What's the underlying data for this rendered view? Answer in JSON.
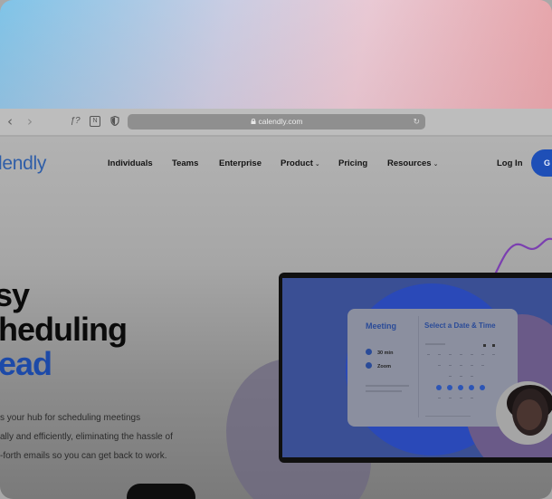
{
  "browser": {
    "url": "calendly.com",
    "back_icon": "chevron-left-icon",
    "forward_icon": "chevron-right-icon",
    "ext1_label": "ƒ?",
    "ext2_label": "N",
    "reload_icon": "reload-icon"
  },
  "site": {
    "logo": "lendly",
    "nav": [
      {
        "label": "Individuals"
      },
      {
        "label": "Teams"
      },
      {
        "label": "Enterprise"
      },
      {
        "label": "Product",
        "caret": "⌄"
      },
      {
        "label": "Pricing"
      },
      {
        "label": "Resources",
        "caret": "⌄"
      }
    ],
    "login": "Log In",
    "cta": "G"
  },
  "hero": {
    "line1": "sy",
    "line2": "heduling",
    "line3": "ead",
    "sub1": "s your hub for scheduling meetings",
    "sub2": "ally and efficiently, eliminating the hassle of",
    "sub3": "-forth emails so you can get back to work."
  },
  "mockup": {
    "meeting_title": "Meeting",
    "date_title": "Select a Date & Time",
    "duration": "30 min",
    "location": "Zoom"
  },
  "colors": {
    "brand_blue": "#1d4aa8",
    "cta_blue": "#1e4fb7"
  }
}
